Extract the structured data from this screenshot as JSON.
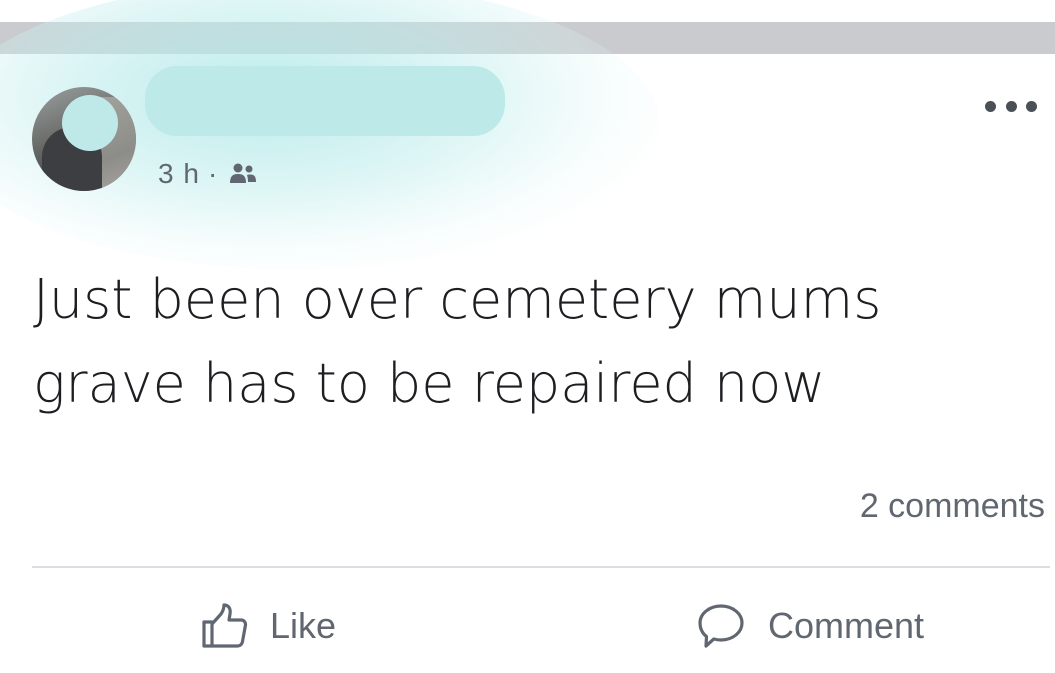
{
  "post": {
    "time": "3 h",
    "separator": "·",
    "audience_icon": "friends-icon",
    "text_line1": "Just been over cemetery mums",
    "text_line2": "grave has to be repaired now",
    "comment_count": "2 comments"
  },
  "actions": {
    "like_label": "Like",
    "comment_label": "Comment"
  },
  "colors": {
    "redaction": "#bde9e8",
    "header_bar": "#cacbce",
    "text_secondary": "#616770",
    "text_primary": "#1c1e21"
  }
}
